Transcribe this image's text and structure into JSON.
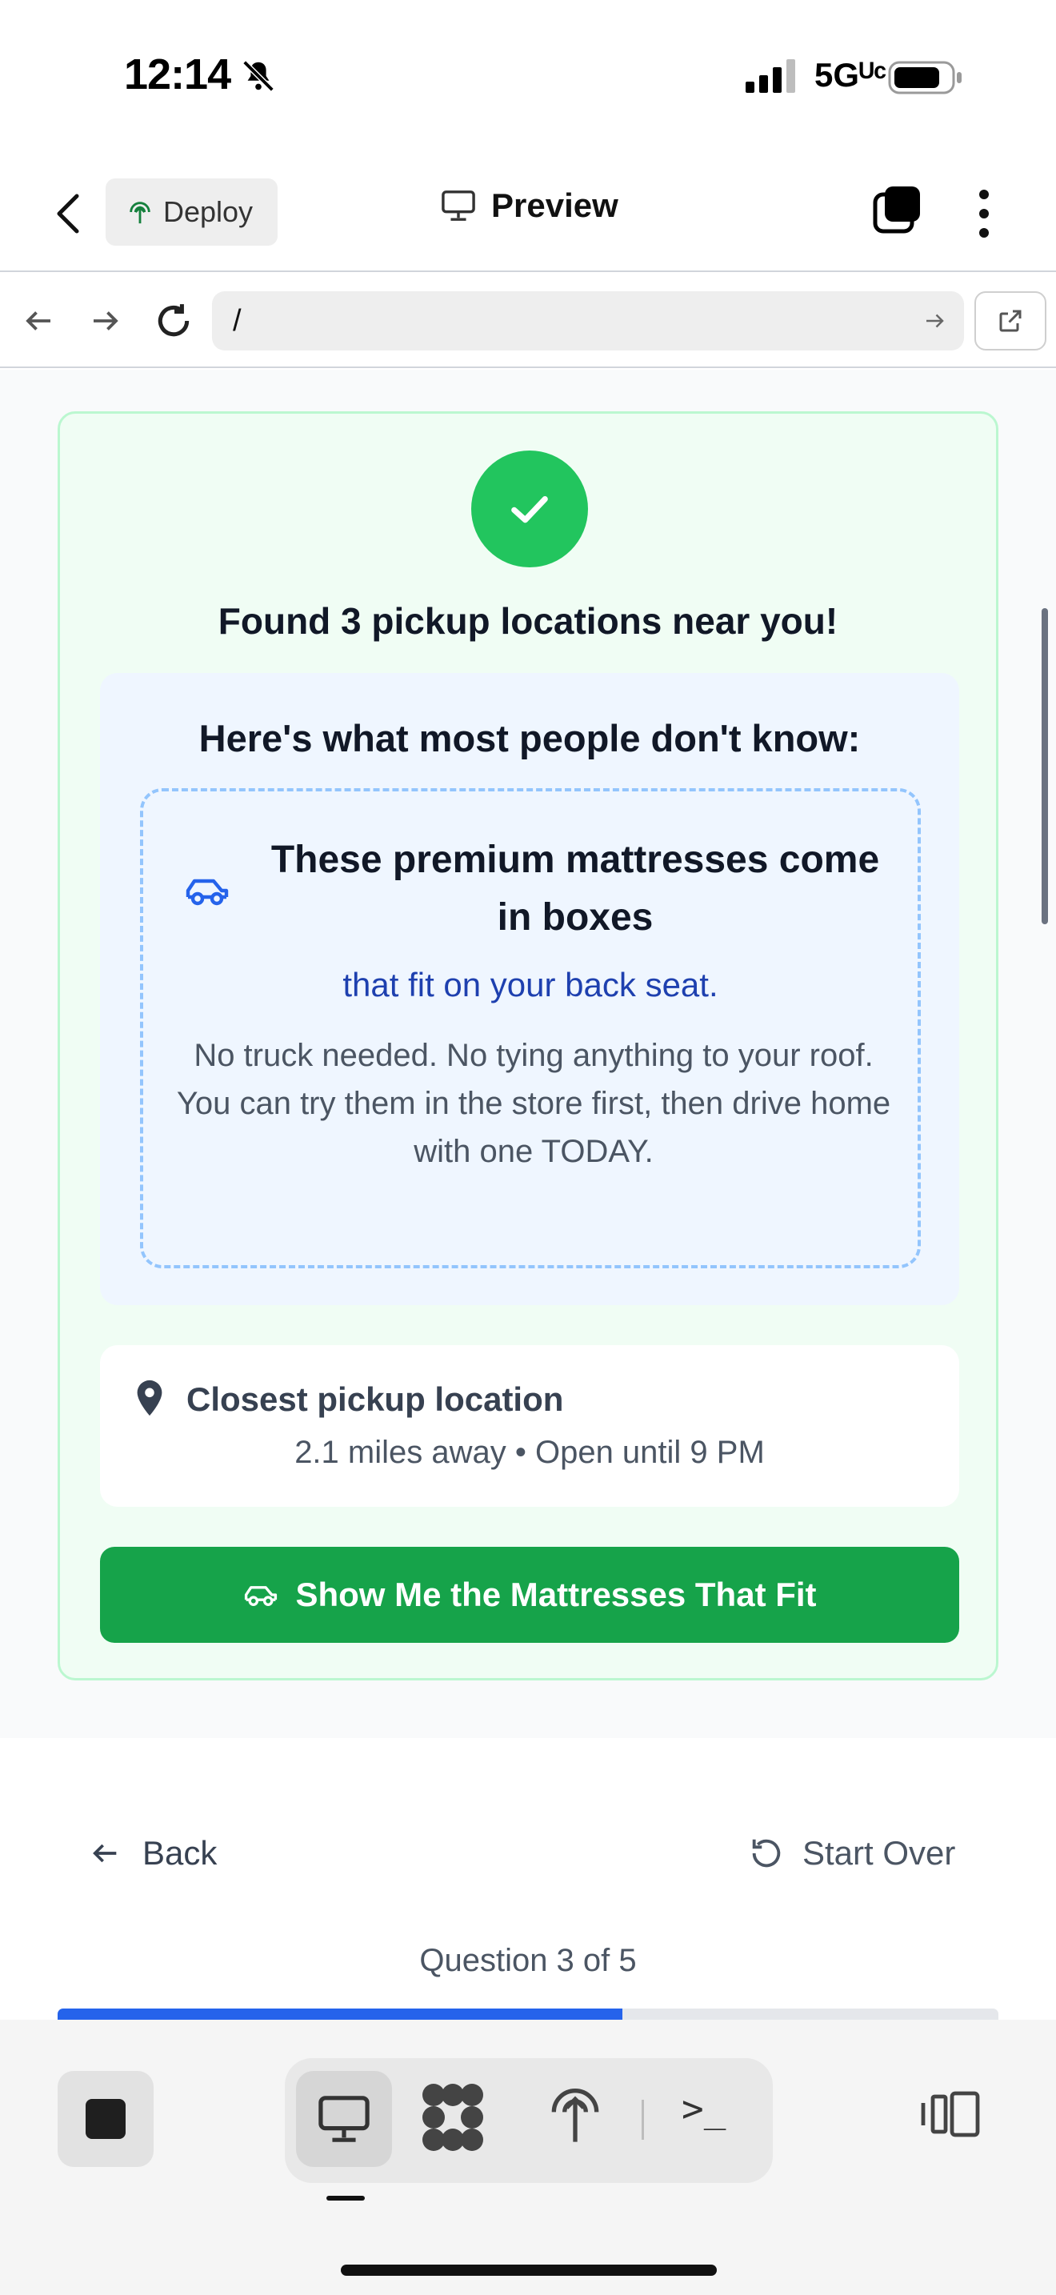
{
  "status_bar": {
    "time": "12:14",
    "network": "5Gᵁᶜ"
  },
  "header": {
    "deploy_label": "Deploy",
    "preview_label": "Preview"
  },
  "browser": {
    "url": "/"
  },
  "result": {
    "title": "Found 3 pickup locations near you!",
    "info_heading": "Here's what most people don't know:",
    "premium_title": "These premium mattresses come in boxes",
    "back_seat": "that fit on your back seat.",
    "desc_line1": "No truck needed. No tying anything to your roof.",
    "desc_line2": "You can try them in the store first, then drive home with one TODAY.",
    "pickup_title": "Closest pickup location",
    "pickup_detail": "2.1 miles away • Open until 9 PM",
    "cta_label": "Show Me the Mattresses That Fit"
  },
  "nav": {
    "back_label": "Back",
    "start_over_label": "Start Over",
    "question_count": "Question 3 of 5",
    "progress_fraction": 0.6
  },
  "colors": {
    "success": "#22c55e",
    "cta": "#16a34a",
    "progress": "#2563eb",
    "highlight_text": "#1e40af"
  },
  "icons": {
    "bell": "bell-slash-icon",
    "car": "car-icon",
    "pin": "map-pin-icon",
    "check": "check-icon"
  }
}
